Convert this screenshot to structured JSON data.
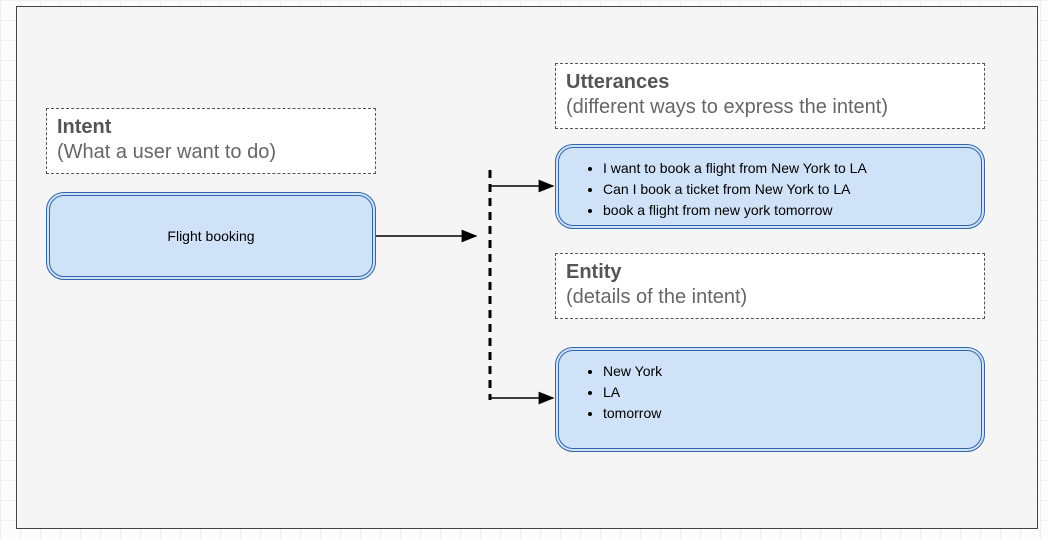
{
  "intent": {
    "header_title": "Intent",
    "header_subtitle": "(What a user want to do)",
    "value": "Flight booking"
  },
  "utterances": {
    "header_title": "Utterances",
    "header_subtitle": "(different ways to express the intent)",
    "items": [
      "I want to book a flight from New York to LA",
      "Can I book a ticket from New York to LA",
      "book a flight from new york tomorrow"
    ]
  },
  "entity": {
    "header_title": "Entity",
    "header_subtitle": "(details of the intent)",
    "items": [
      "New York",
      "LA",
      "tomorrow"
    ]
  }
}
